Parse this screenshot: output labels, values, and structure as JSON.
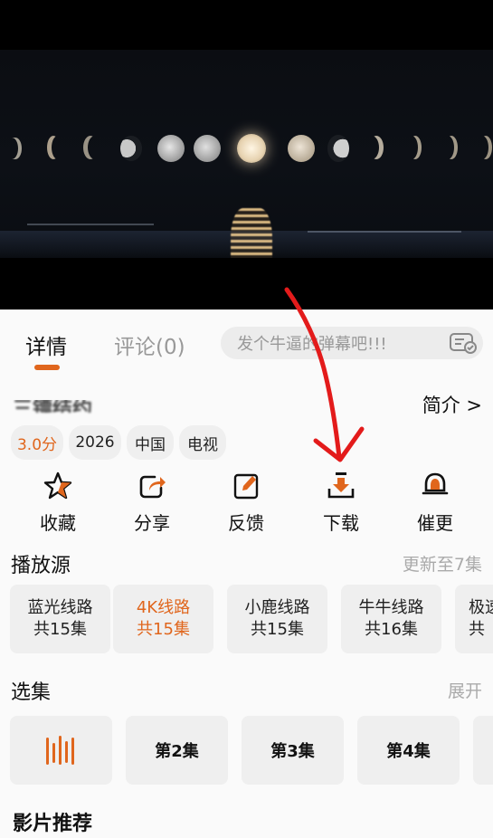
{
  "player": {
    "scene": "moon-phases-over-sea"
  },
  "tabs": {
    "details": "详情",
    "comments": "评论(0)"
  },
  "danmaku": {
    "placeholder": "发个牛逼的弹幕吧!!!"
  },
  "title_row": {
    "title_partial": "三镖结约",
    "intro_link": "简介 >"
  },
  "tags": [
    "3.0分",
    "2026",
    "中国",
    "电视"
  ],
  "actions": {
    "favorite": "收藏",
    "share": "分享",
    "feedback": "反馈",
    "download": "下载",
    "urge": "催更"
  },
  "sources": {
    "title": "播放源",
    "update_status": "更新至7集",
    "items": [
      {
        "name": "蓝光线路",
        "count": "共15集"
      },
      {
        "name": "4K线路",
        "count": "共15集"
      },
      {
        "name": "小鹿线路",
        "count": "共15集"
      },
      {
        "name": "牛牛线路",
        "count": "共16集"
      },
      {
        "name": "极速",
        "count": "共"
      }
    ]
  },
  "episodes": {
    "title": "选集",
    "expand": "展开",
    "items": [
      "第2集",
      "第3集",
      "第4集"
    ]
  },
  "recommend": {
    "title": "影片推荐"
  },
  "colors": {
    "accent": "#e0661d",
    "annotation_arrow": "#e31b1b"
  }
}
